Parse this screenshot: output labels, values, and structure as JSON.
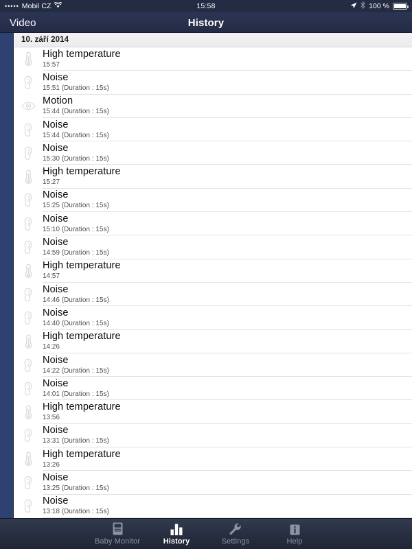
{
  "status_bar": {
    "signal_dots": "•••••",
    "carrier": "Mobil CZ",
    "wifi_icon": "wifi-icon",
    "time": "15:58",
    "location_icon": "location-arrow-icon",
    "bluetooth_icon": "bluetooth-icon",
    "battery_percent": "100 %",
    "battery_icon": "battery-full-icon"
  },
  "navbar": {
    "back_label": "Video",
    "title": "History"
  },
  "list": {
    "section_header": "10. září 2014",
    "rows": [
      {
        "icon": "thermometer-icon",
        "title": "High temperature",
        "subtitle": "15:57"
      },
      {
        "icon": "ear-icon",
        "title": "Noise",
        "subtitle": "15:51 (Duration : 15s)"
      },
      {
        "icon": "eye-icon",
        "title": "Motion",
        "subtitle": "15:44 (Duration : 15s)"
      },
      {
        "icon": "ear-icon",
        "title": "Noise",
        "subtitle": "15:44 (Duration : 15s)"
      },
      {
        "icon": "ear-icon",
        "title": "Noise",
        "subtitle": "15:30 (Duration : 15s)"
      },
      {
        "icon": "thermometer-icon",
        "title": "High temperature",
        "subtitle": "15:27"
      },
      {
        "icon": "ear-icon",
        "title": "Noise",
        "subtitle": "15:25 (Duration : 15s)"
      },
      {
        "icon": "ear-icon",
        "title": "Noise",
        "subtitle": "15:10 (Duration : 15s)"
      },
      {
        "icon": "ear-icon",
        "title": "Noise",
        "subtitle": "14:59 (Duration : 15s)"
      },
      {
        "icon": "thermometer-icon",
        "title": "High temperature",
        "subtitle": "14:57"
      },
      {
        "icon": "ear-icon",
        "title": "Noise",
        "subtitle": "14:46 (Duration : 15s)"
      },
      {
        "icon": "ear-icon",
        "title": "Noise",
        "subtitle": "14:40 (Duration : 15s)"
      },
      {
        "icon": "thermometer-icon",
        "title": "High temperature",
        "subtitle": "14:26"
      },
      {
        "icon": "ear-icon",
        "title": "Noise",
        "subtitle": "14:22 (Duration : 15s)"
      },
      {
        "icon": "ear-icon",
        "title": "Noise",
        "subtitle": "14:01 (Duration : 15s)"
      },
      {
        "icon": "thermometer-icon",
        "title": "High temperature",
        "subtitle": "13:56"
      },
      {
        "icon": "ear-icon",
        "title": "Noise",
        "subtitle": "13:31 (Duration : 15s)"
      },
      {
        "icon": "thermometer-icon",
        "title": "High temperature",
        "subtitle": "13:26"
      },
      {
        "icon": "ear-icon",
        "title": "Noise",
        "subtitle": "13:25 (Duration : 15s)"
      },
      {
        "icon": "ear-icon",
        "title": "Noise",
        "subtitle": "13:18 (Duration : 15s)"
      }
    ]
  },
  "tabbar": {
    "active_index": 1,
    "tabs": [
      {
        "label": "Baby Monitor",
        "icon": "baby-monitor-icon"
      },
      {
        "label": "History",
        "icon": "bar-chart-icon"
      },
      {
        "label": "Settings",
        "icon": "wrench-icon"
      },
      {
        "label": "Help",
        "icon": "info-icon"
      }
    ]
  },
  "colors": {
    "navbar": "#2b3453",
    "statusbar": "#242c43",
    "left_strip": "#2e4272",
    "tabbar": "#272e40",
    "tab_active": "#ffffff",
    "tab_inactive": "#8d93a3",
    "row_title": "#0d0d0d",
    "row_subtitle": "#4a4a4a",
    "separator": "#e2e2e4"
  }
}
